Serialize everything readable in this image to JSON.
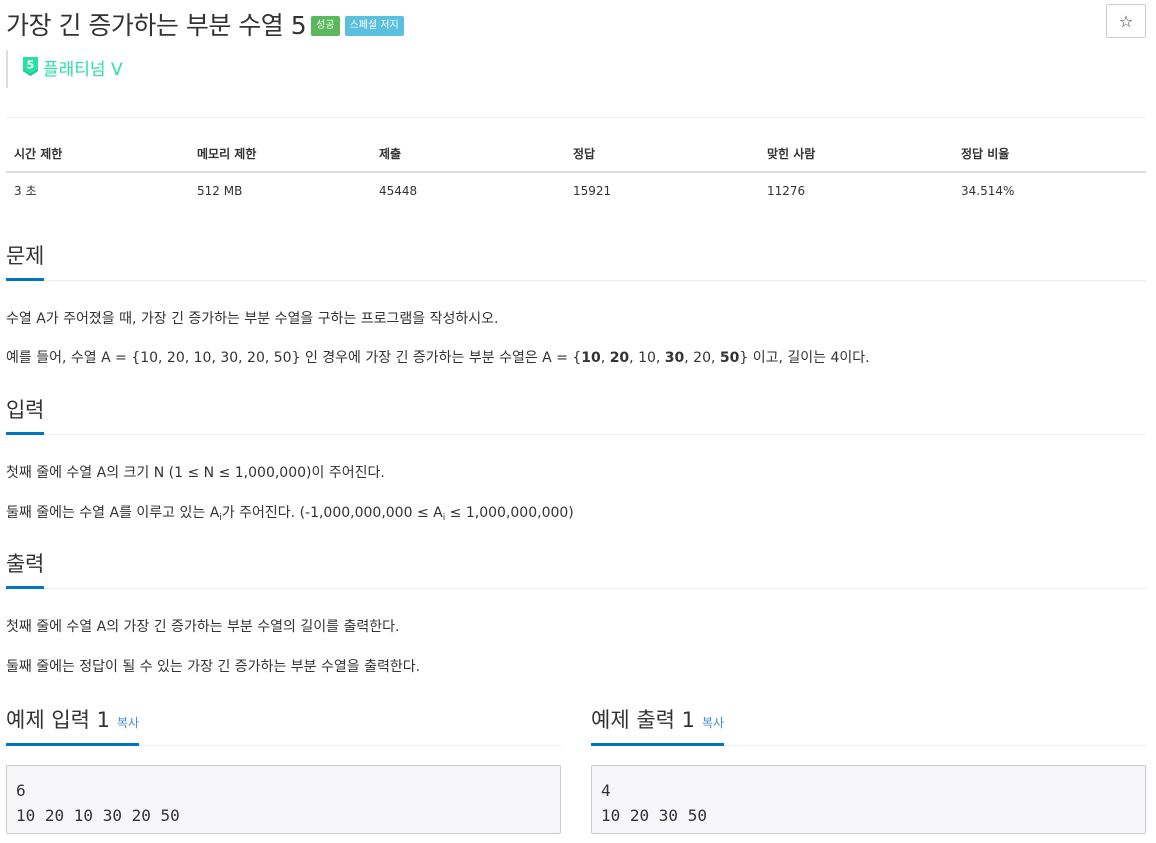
{
  "problem": {
    "title": "가장 긴 증가하는 부분 수열 5",
    "badges": {
      "success": "성공",
      "special_judge": "스페셜 저지"
    },
    "tier": {
      "icon_number": "5",
      "label": "플래티넘 V",
      "color": "#27e2a4"
    },
    "star_button": "☆"
  },
  "info_table": {
    "headers": [
      "시간 제한",
      "메모리 제한",
      "제출",
      "정답",
      "맞힌 사람",
      "정답 비율"
    ],
    "values": [
      "3 초",
      "512 MB",
      "45448",
      "15921",
      "11276",
      "34.514%"
    ]
  },
  "sections": {
    "description": {
      "heading": "문제",
      "p1": "수열 A가 주어졌을 때, 가장 긴 증가하는 부분 수열을 구하는 프로그램을 작성하시오.",
      "p2": {
        "prefix": "예를 들어, 수열 A = {10, 20, 10, 30, 20, 50} 인 경우에 가장 긴 증가하는 부분 수열은 A = {",
        "v1": "10",
        "s1": ", ",
        "v2": "20",
        "s2": ", 10, ",
        "v3": "30",
        "s3": ", 20, ",
        "v4": "50",
        "suffix": "} 이고, 길이는 4이다."
      }
    },
    "input": {
      "heading": "입력",
      "p1": "첫째 줄에 수열 A의 크기 N (1 ≤ N ≤ 1,000,000)이 주어진다.",
      "p2": {
        "prefix": "둘째 줄에는 수열 A를 이루고 있는 A",
        "sub1": "i",
        "middle": "가 주어진다. (-1,000,000,000 ≤ A",
        "sub2": "i",
        "suffix": " ≤ 1,000,000,000)"
      }
    },
    "output": {
      "heading": "출력",
      "p1": "첫째 줄에 수열 A의 가장 긴 증가하는 부분 수열의 길이를 출력한다.",
      "p2": "둘째 줄에는 정답이 될 수 있는 가장 긴 증가하는 부분 수열을 출력한다."
    }
  },
  "samples": {
    "input": {
      "heading": "예제 입력 1",
      "copy": "복사",
      "lines": [
        "6",
        "10 20 10 30 20 50"
      ]
    },
    "output": {
      "heading": "예제 출력 1",
      "copy": "복사",
      "lines": [
        "4",
        "10 20 30 50"
      ]
    }
  }
}
